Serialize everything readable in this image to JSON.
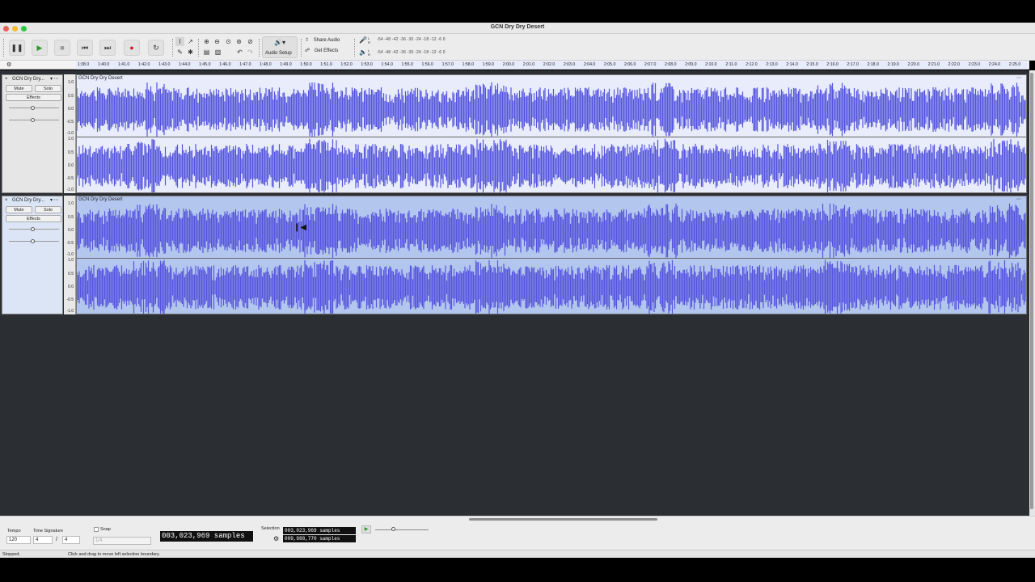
{
  "window": {
    "title": "GCN Dry Dry Desert"
  },
  "transport": {
    "pause": "pause-icon",
    "play": "play-icon",
    "stop": "stop-icon",
    "skip_start": "skip-to-start-icon",
    "skip_end": "skip-to-end-icon",
    "record": "record-icon",
    "loop": "loop-icon"
  },
  "toolbar": {
    "audio_setup_label": "Audio Setup",
    "share_audio_label": "Share Audio",
    "get_effects_label": "Get Effects",
    "record_meter_scale": "-54  -48  -42  -36  -30  -24  -18  -12   -6   0",
    "play_meter_scale": "-54  -48  -42  -36  -30  -24  -18  -12   -6   0"
  },
  "ruler": {
    "ticks": [
      "1:38.0",
      "1:40.0",
      "1:41.0",
      "1:42.0",
      "1:43.0",
      "1:44.0",
      "1:45.0",
      "1:46.0",
      "1:47.0",
      "1:48.0",
      "1:49.0",
      "1:50.0",
      "1:51.0",
      "1:52.0",
      "1:53.0",
      "1:54.0",
      "1:55.0",
      "1:56.0",
      "1:57.0",
      "1:58.0",
      "1:59.0",
      "2:00.0",
      "2:01.0",
      "2:02.0",
      "2:03.0",
      "2:04.0",
      "2:05.0",
      "2:06.0",
      "2:07.0",
      "2:08.0",
      "2:09.0",
      "2:10.0",
      "2:11.0",
      "2:12.0",
      "2:13.0",
      "2:14.0",
      "2:15.0",
      "2:16.0",
      "2:17.0",
      "2:18.0",
      "2:19.0",
      "2:20.0",
      "2:21.0",
      "2:22.0",
      "2:23.0",
      "2:24.0",
      "2:25.0"
    ]
  },
  "tracks": [
    {
      "name": "GCN Dry Dry...",
      "clip_name": "GCN Dry Dry Desert",
      "mute": "Mute",
      "solo": "Solo",
      "effects": "Effects",
      "selected": false
    },
    {
      "name": "GCN Dry Dry...",
      "clip_name": "GCN Dry Dry Desert",
      "mute": "Mute",
      "solo": "Solo",
      "effects": "Effects",
      "selected": true
    }
  ],
  "vscale": {
    "top": "1.0",
    "upper": "0.5",
    "mid": "0.0",
    "lower": "-0.5",
    "bottom": "-1.0"
  },
  "bottom": {
    "tempo_label": "Tempo",
    "tempo_value": "120",
    "time_sig_label": "Time Signature",
    "time_sig_num": "4",
    "time_sig_den": "4",
    "snap_label": "Snap",
    "snap_value": "1/4",
    "audio_position": "003,023,969 samples",
    "selection_label": "Selection",
    "selection_start": "003,023,969 samples",
    "selection_end": "009,988,770 samples"
  },
  "status": {
    "state": "Stopped.",
    "hint": "Click and drag to move left selection boundary."
  },
  "colors": {
    "waveform": "#5555dd",
    "waveform_bg": "#e8ecfb",
    "selected_bg": "#b3c6ee",
    "record": "#cc2222"
  }
}
